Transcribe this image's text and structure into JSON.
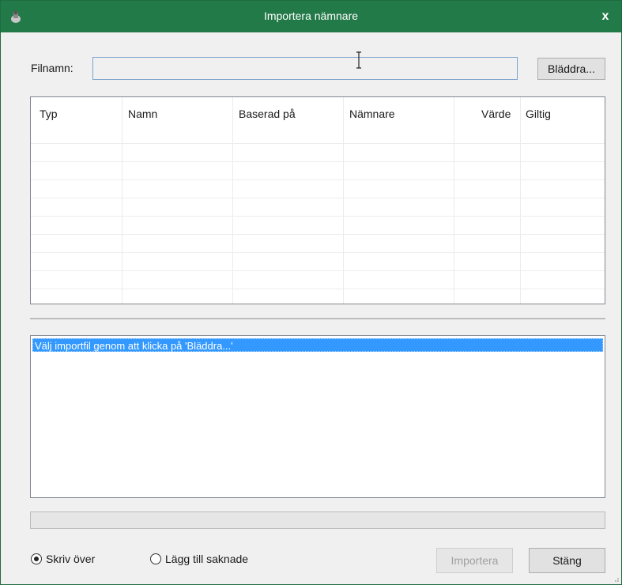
{
  "window": {
    "title": "Importera nämnare",
    "close_glyph": "x",
    "icon": "app-icon"
  },
  "file": {
    "label": "Filnamn:",
    "value": "",
    "browse_label": "Bläddra..."
  },
  "grid": {
    "columns": [
      "Typ",
      "Namn",
      "Baserad på",
      "Nämnare",
      "Värde",
      "Giltig"
    ],
    "rows": []
  },
  "log": {
    "items": [
      "Välj importfil genom att klicka på 'Bläddra...'"
    ]
  },
  "progress": {
    "value": 0
  },
  "options": {
    "overwrite_label": "Skriv över",
    "add_missing_label": "Lägg till saknade",
    "selected": "overwrite"
  },
  "buttons": {
    "import_label": "Importera",
    "close_label": "Stäng"
  },
  "colors": {
    "titlebar": "#237a49",
    "selection": "#3399ff"
  }
}
